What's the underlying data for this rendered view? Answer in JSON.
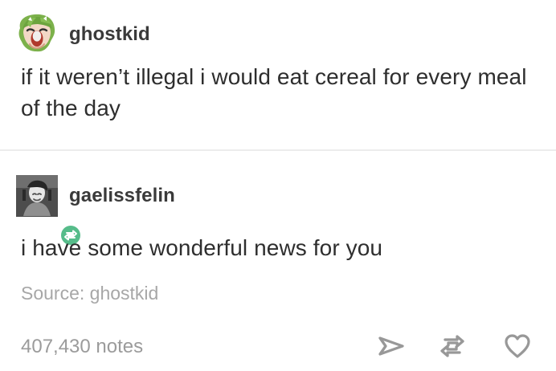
{
  "post": {
    "original": {
      "username": "ghostkid",
      "text": "if it weren’t illegal i would eat cereal for every meal of the day",
      "avatar_icon": "anime-girl-avatar-icon"
    },
    "reblog": {
      "username": "gaelissfelin",
      "text": "i have some wonderful news for you",
      "avatar_icon": "user-photo-avatar-icon",
      "badge_icon": "reblog-badge-icon"
    },
    "source": "Source: ghostkid",
    "notes": "407,430 notes",
    "actions": {
      "share_icon": "share-icon",
      "reblog_icon": "reblog-icon",
      "like_icon": "heart-icon"
    },
    "colors": {
      "reblog_badge": "#56bc8a",
      "text": "#2e2e2e",
      "meta": "#9b9b9b"
    }
  }
}
